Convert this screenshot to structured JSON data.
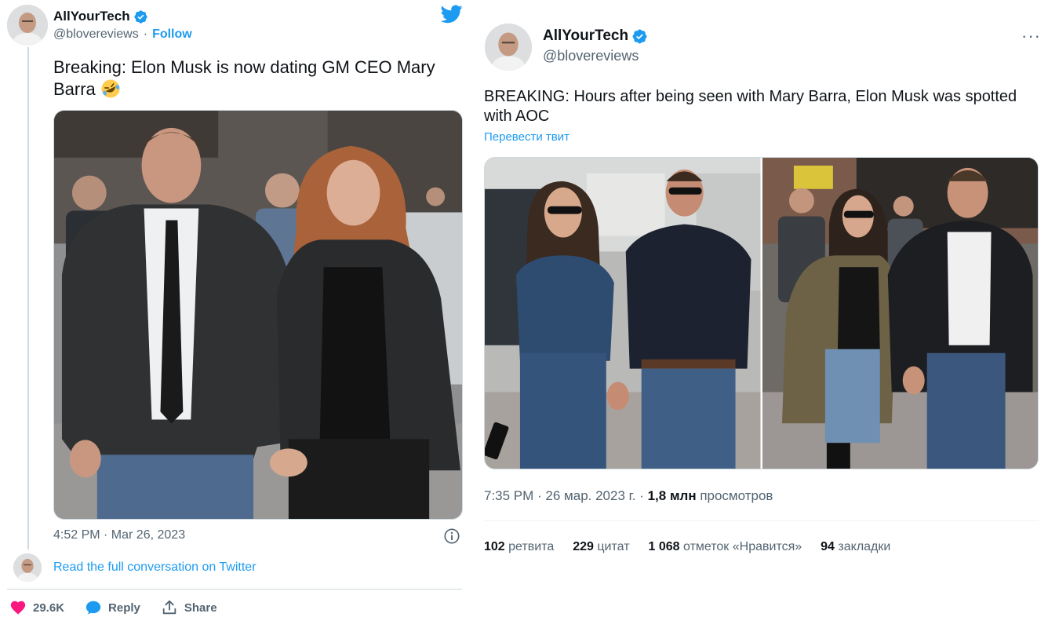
{
  "left_tweet": {
    "author_name": "AllYourTech",
    "author_handle": "@blovereviews",
    "follow_label": "Follow",
    "text": "Breaking: Elon Musk is now dating GM CEO Mary Barra",
    "emoji": "rolling-on-floor-laughing",
    "timestamp": "4:52 PM · Mar 26, 2023",
    "read_more_label": "Read the full conversation on Twitter",
    "actions": {
      "likes": "29.6K",
      "reply_label": "Reply",
      "share_label": "Share"
    }
  },
  "right_tweet": {
    "author_name": "AllYourTech",
    "author_handle": "@blovereviews",
    "more_label": "···",
    "text": "BREAKING: Hours after being seen with Mary Barra, Elon Musk was spotted with AOC",
    "translate_label": "Перевести твит",
    "meta": {
      "time_date": "7:35 PM · 26 мар. 2023 г. · ",
      "views_count": "1,8 млн",
      "views_label": " просмотров"
    },
    "stats": [
      {
        "count": "102",
        "label": "ретвита"
      },
      {
        "count": "229",
        "label": "цитат"
      },
      {
        "count": "1 068",
        "label": "отметок «Нравится»"
      },
      {
        "count": "94",
        "label": "закладки"
      }
    ]
  },
  "colors": {
    "accent": "#1d9bf0",
    "like": "#f91880",
    "secondary_text": "#536471",
    "divider": "#cfd9de"
  }
}
